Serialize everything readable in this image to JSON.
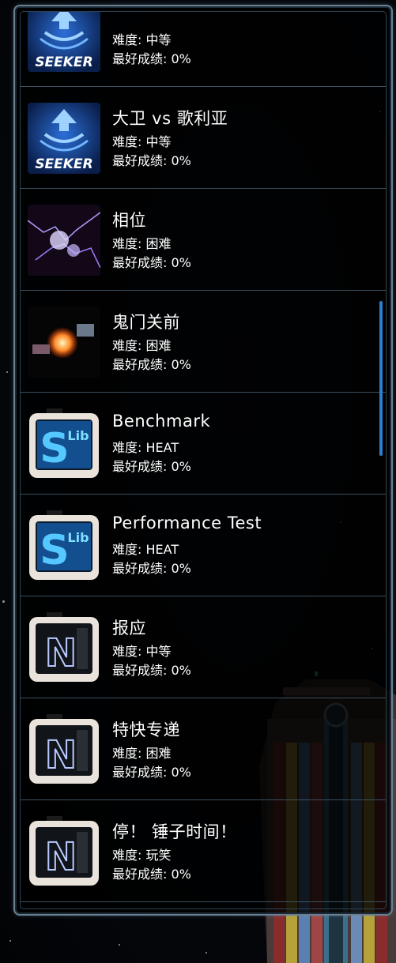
{
  "labels": {
    "difficulty_prefix": "难度: ",
    "best_prefix": "最好成绩: "
  },
  "items": [
    {
      "title": "",
      "difficulty": "中等",
      "best": "0%",
      "thumb": "seeker",
      "thumb_label": "SEEKER"
    },
    {
      "title": "大卫 vs 歌利亚",
      "difficulty": "中等",
      "best": "0%",
      "thumb": "seeker",
      "thumb_label": "SEEKER"
    },
    {
      "title": "相位",
      "difficulty": "困难",
      "best": "0%",
      "thumb": "lightning"
    },
    {
      "title": "鬼门关前",
      "difficulty": "困难",
      "best": "0%",
      "thumb": "explosion"
    },
    {
      "title": "Benchmark",
      "difficulty": "HEAT",
      "best": "0%",
      "thumb": "slib",
      "thumb_label": "S",
      "thumb_label_small": "Lib"
    },
    {
      "title": "Performance Test",
      "difficulty": "HEAT",
      "best": "0%",
      "thumb": "slib",
      "thumb_label": "S",
      "thumb_label_small": "Lib"
    },
    {
      "title": "报应",
      "difficulty": "中等",
      "best": "0%",
      "thumb": "n",
      "thumb_label": "N"
    },
    {
      "title": "特快专递",
      "difficulty": "困难",
      "best": "0%",
      "thumb": "n",
      "thumb_label": "N"
    },
    {
      "title": "停！ 锤子时间！",
      "difficulty": "玩笑",
      "best": "0%",
      "thumb": "n",
      "thumb_label": "N"
    }
  ],
  "colors": {
    "accent": "#2a7fd0",
    "panel_border": "#6a7f90",
    "divider": "#3b5060"
  }
}
